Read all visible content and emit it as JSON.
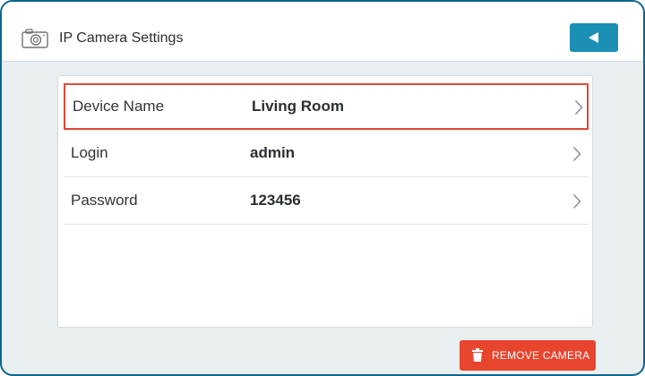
{
  "header": {
    "title": "IP Camera Settings",
    "camera_icon": "camera-icon",
    "back_icon": "back-arrow-icon",
    "accent_color": "#1b8fb4"
  },
  "settings": {
    "rows": [
      {
        "label": "Device Name",
        "value": "Living Room",
        "selected": true
      },
      {
        "label": "Login",
        "value": "admin",
        "selected": false
      },
      {
        "label": "Password",
        "value": "123456",
        "selected": false
      }
    ],
    "chevron_icon": "chevron-right-icon",
    "selected_border_color": "#e04a36"
  },
  "footer": {
    "remove_label": "REMOVE CAMERA",
    "remove_icon": "trash-icon",
    "remove_color": "#e8452f"
  }
}
